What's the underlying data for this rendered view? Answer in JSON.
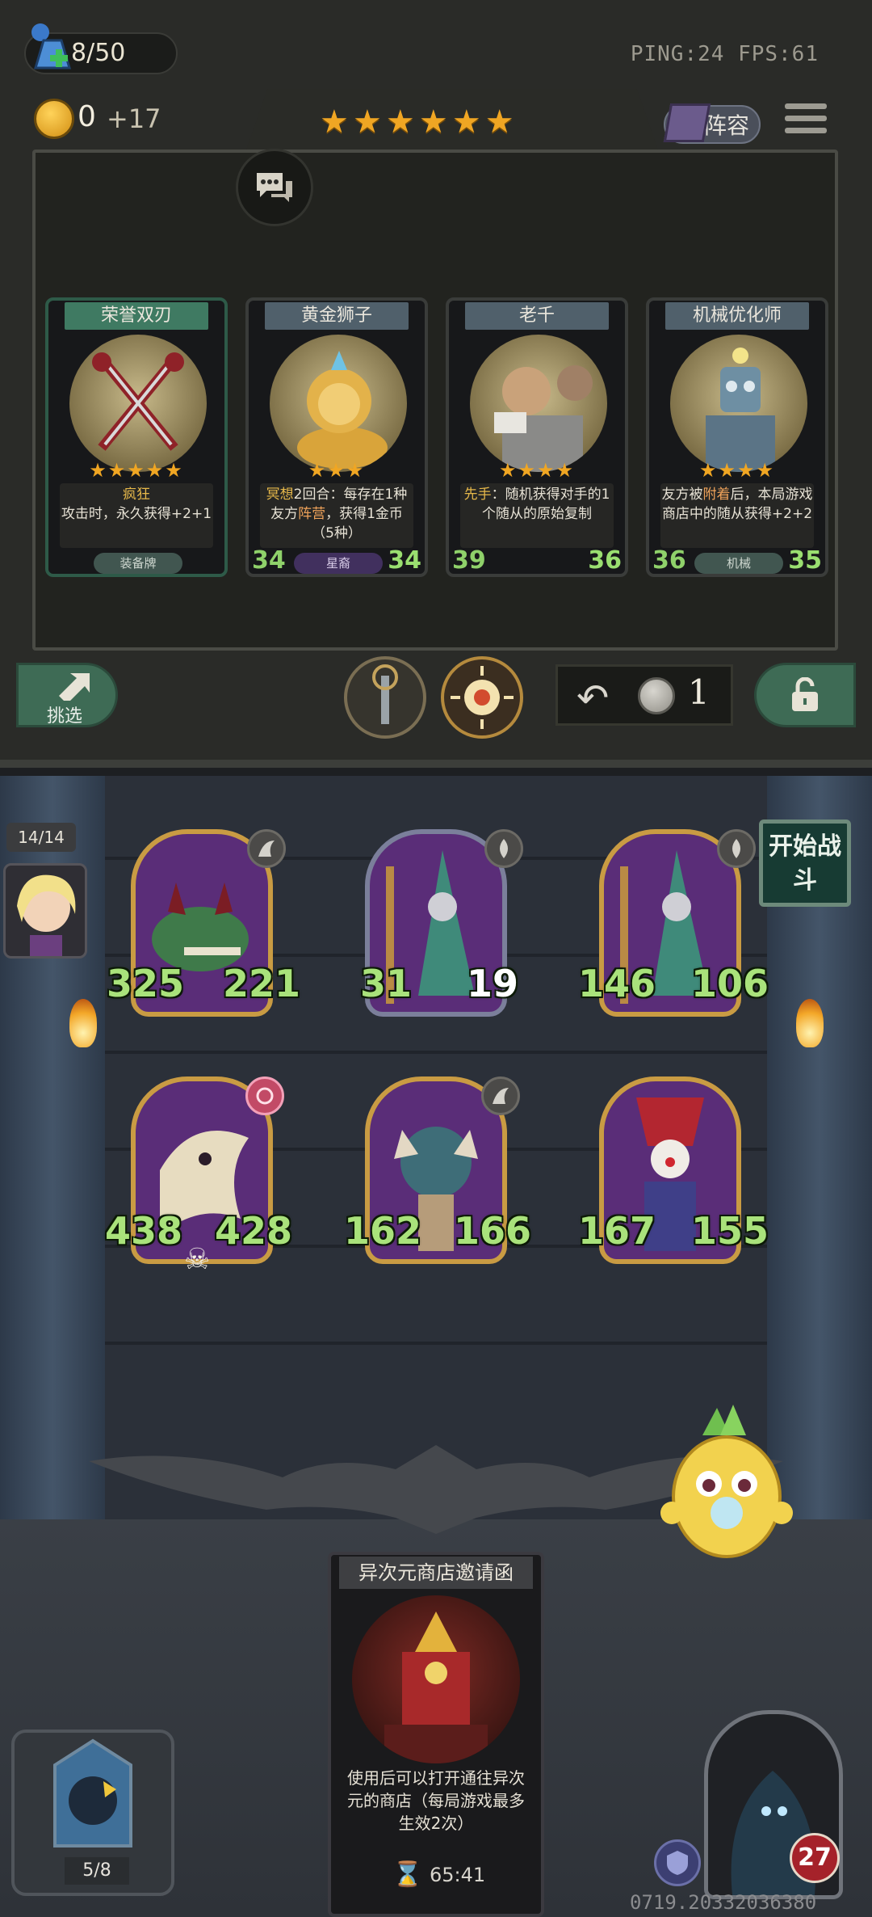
{
  "header": {
    "population": "8/50",
    "gold": "0",
    "gold_income": "+17",
    "ping_fps": "PING:24  FPS:61",
    "lineup_label": "阵容",
    "tavern_stars": 6
  },
  "shop": {
    "cards": [
      {
        "title": "荣誉双刃",
        "stars": "★★★★★",
        "desc_keyword": "疯狂",
        "desc": "攻击时，永久获得+2+1",
        "tag": "装备牌",
        "attack": "",
        "health": ""
      },
      {
        "title": "黄金狮子",
        "stars": "★★★",
        "desc_keyword": "冥想",
        "desc_a": "2回合：每存在1种友方",
        "desc_keyword2": "阵营",
        "desc_b": "，获得1金币（5种）",
        "tag": "星裔",
        "attack": "34",
        "health": "34"
      },
      {
        "title": "老千",
        "stars": "★★★★",
        "desc_keyword": "先手",
        "desc": "：随机获得对手的1个随从的原始复制",
        "tag": "",
        "attack": "39",
        "health": "36"
      },
      {
        "title": "机械优化师",
        "stars": "★★★★",
        "desc_a": "友方被",
        "desc_keyword": "附着",
        "desc_b": "后，本局游戏商店中的随从获得+2+2",
        "tag": "机械",
        "attack": "36",
        "health": "35"
      }
    ],
    "pick_label": "挑选",
    "refresh_cost": "1"
  },
  "board": {
    "round": "14/14",
    "start_battle": "开始战斗",
    "minions": [
      {
        "attack": "325",
        "health": "221",
        "hurt": false
      },
      {
        "attack": "31",
        "health": "19",
        "hurt": true
      },
      {
        "attack": "146",
        "health": "106",
        "hurt": false
      },
      {
        "attack": "438",
        "health": "428",
        "hurt": false
      },
      {
        "attack": "162",
        "health": "166",
        "hurt": false
      },
      {
        "attack": "167",
        "health": "155",
        "hurt": false
      }
    ]
  },
  "hand": {
    "card_title": "异次元商店邀请函",
    "card_desc": "使用后可以打开通往异次元的商店（每局游戏最多生效2次）"
  },
  "footer": {
    "deck_count": "5/8",
    "timer": "65:41",
    "hero_health": "27",
    "build_id": "0719.20332036380"
  },
  "colors": {
    "gold_star": "#f0a623",
    "stat_green": "#a9e27b",
    "panel_green": "#3e6b55",
    "minion_gold_frame": "#c99b43"
  }
}
